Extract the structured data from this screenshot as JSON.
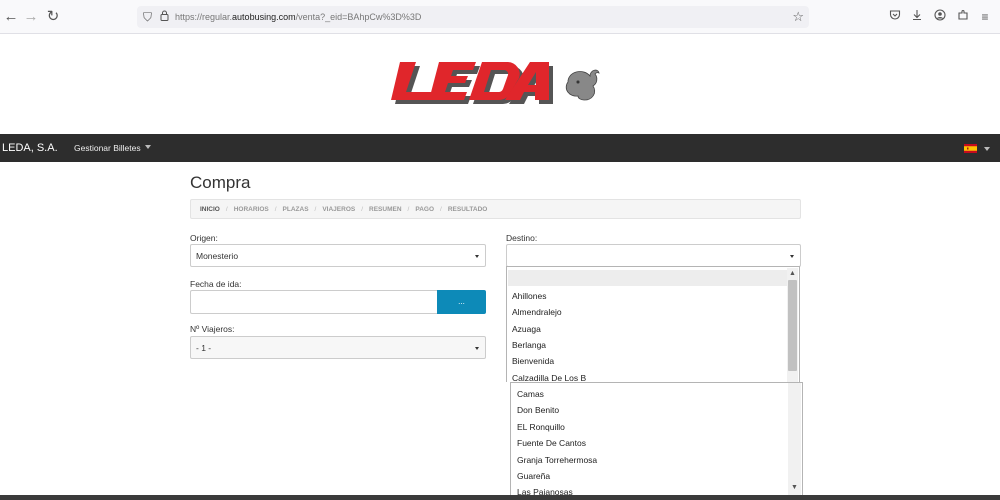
{
  "browser": {
    "url_prefix": "https://regular.",
    "url_domain": "autobusing.com",
    "url_path": "/venta?_eid=BAhpCw%3D%3D"
  },
  "navbar": {
    "brand": "LEDA, S.A.",
    "menu_label": "Gestionar Billetes"
  },
  "page": {
    "title": "Compra",
    "breadcrumb": [
      "INICIO",
      "HORARIOS",
      "PLAZAS",
      "VIAJEROS",
      "RESUMEN",
      "PAGO",
      "RESULTADO"
    ]
  },
  "form": {
    "origen_label": "Origen:",
    "origen_value": "Monesterio",
    "destino_label": "Destino:",
    "destino_value": "",
    "fecha_label": "Fecha de ida:",
    "fecha_value": "",
    "fecha_button": "...",
    "viajeros_label": "Nº Viajeros:",
    "viajeros_value": "- 1 -"
  },
  "destino_options_upper": [
    "Ahillones",
    "Almendralejo",
    "Azuaga",
    "Berlanga",
    "Bienvenida",
    "Calzadilla De Los B"
  ],
  "destino_options_lower": [
    "Camas",
    "Don Benito",
    "EL Ronquillo",
    "Fuente De Cantos",
    "Granja Torrehermosa",
    "Guareña",
    "Las Pajanosas"
  ],
  "colors": {
    "navbar": "#2d2d2d",
    "primary_button": "#0d8ab8",
    "logo_red": "#e0262b"
  }
}
